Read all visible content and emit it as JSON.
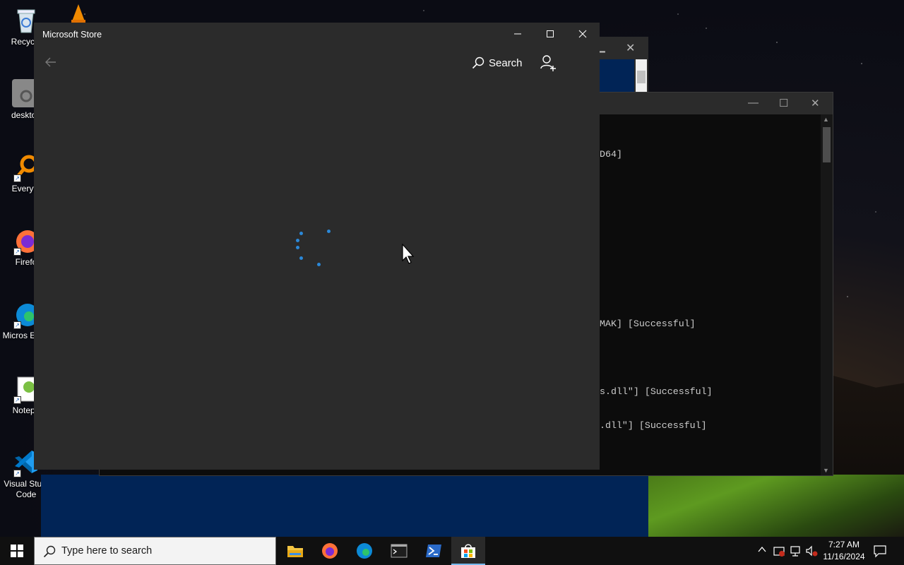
{
  "desktop": {
    "icons": [
      {
        "label": "Recycle",
        "icon": "recycle-bin-icon"
      },
      {
        "label": "desktop",
        "icon": "gear-icon"
      },
      {
        "label": "Everyth",
        "icon": "everything-search-icon"
      },
      {
        "label": "Firefo",
        "icon": "firefox-icon"
      },
      {
        "label": "Micros Edge",
        "icon": "edge-icon"
      },
      {
        "label": "Notepa",
        "icon": "notepad-plus-icon"
      },
      {
        "label": "Visual Studi Code",
        "icon": "vscode-icon"
      }
    ]
  },
  "console": {
    "lines": [
      "D64]",
      "",
      "",
      "",
      "",
      "MAK] [Successful]",
      "",
      "s.dll\"] [Successful]",
      ".dll\"] [Successful]"
    ]
  },
  "store": {
    "title": "Microsoft Store",
    "search_label": "Search",
    "accent": "#2b88d8"
  },
  "taskbar": {
    "search_placeholder": "Type here to search",
    "apps": [
      "file-explorer",
      "firefox",
      "edge",
      "terminal",
      "powershell",
      "microsoft-store"
    ],
    "active_app": "microsoft-store",
    "time": "7:27 AM",
    "date": "11/16/2024"
  }
}
